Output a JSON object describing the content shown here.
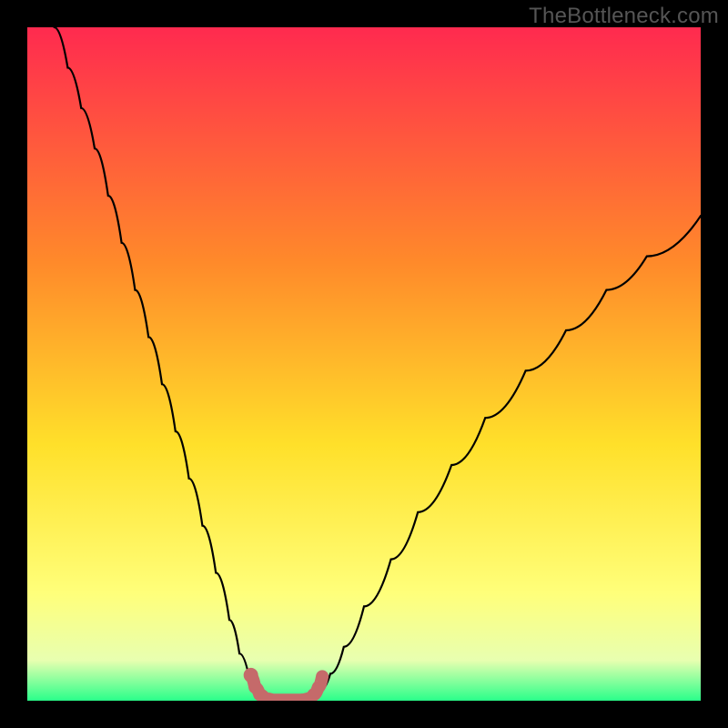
{
  "watermark": "TheBottleneck.com",
  "colors": {
    "frame": "#000000",
    "gradient_top": "#ff2a4f",
    "gradient_mid1": "#ff8a2a",
    "gradient_mid2": "#ffe02a",
    "gradient_mid3": "#ffff7a",
    "gradient_mid4": "#e8ffb0",
    "gradient_bottom": "#2aff8a",
    "curve": "#000000",
    "highlight": "#c56a6a"
  },
  "chart_data": {
    "type": "line",
    "title": "",
    "xlabel": "",
    "ylabel": "",
    "xlim": [
      0,
      100
    ],
    "ylim": [
      0,
      100
    ],
    "series": [
      {
        "name": "left-curve",
        "x": [
          4,
          6,
          8,
          10,
          12,
          14,
          16,
          18,
          20,
          22,
          24,
          26,
          28,
          30,
          31.5,
          33,
          34,
          34.8
        ],
        "y": [
          100,
          94,
          88,
          82,
          75,
          68,
          61,
          54,
          47,
          40,
          33,
          26,
          19,
          12,
          7,
          3.2,
          1.2,
          0.2
        ]
      },
      {
        "name": "right-curve",
        "x": [
          42.5,
          43.5,
          45,
          47,
          50,
          54,
          58,
          63,
          68,
          74,
          80,
          86,
          92,
          100
        ],
        "y": [
          0.2,
          1.5,
          4,
          8,
          14,
          21,
          28,
          35,
          42,
          49,
          55,
          61,
          66,
          72
        ]
      },
      {
        "name": "highlight-segment",
        "x": [
          33.2,
          33.8,
          34.5,
          35.3,
          36.5,
          38.5,
          40.5,
          41.7,
          42.5,
          43.2,
          43.8
        ],
        "y": [
          3.6,
          2.0,
          0.9,
          0.3,
          0.1,
          0.1,
          0.1,
          0.3,
          0.9,
          2.0,
          3.6
        ]
      }
    ],
    "highlight_dot": {
      "x": 33.2,
      "y": 3.8
    }
  }
}
